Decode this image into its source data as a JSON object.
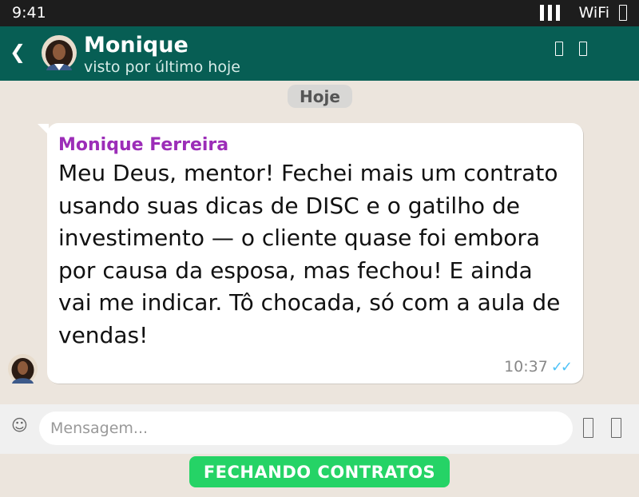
{
  "status_bar": {
    "time": "9:41",
    "wifi_label": "WiFi",
    "battery_icon": "battery-icon"
  },
  "header": {
    "back_icon": "chevron-left-icon",
    "contact_name": "Monique",
    "contact_status": "visto por último hoje",
    "icons": [
      "video-icon",
      "phone-icon"
    ],
    "color": "#075e54"
  },
  "chat": {
    "date_label": "Hoje",
    "message": {
      "sender": "Monique Ferreira",
      "text": "Meu Deus, mentor! Fechei mais um contrato usando suas dicas de DISC e o gatilho de investimento — o cliente quase foi embora por causa da esposa, mas fechou! E ainda vai me indicar. Tô chocada, só com a aula de vendas!",
      "time": "10:37",
      "ticks": "✓✓",
      "sender_color": "#9c2db8"
    }
  },
  "input": {
    "emoji_icon": "☺",
    "placeholder": "Mensagem...",
    "icons": [
      "attach-icon",
      "mic-icon"
    ]
  },
  "cta": {
    "label": "FECHANDO CONTRATOS",
    "color": "#25d366"
  }
}
